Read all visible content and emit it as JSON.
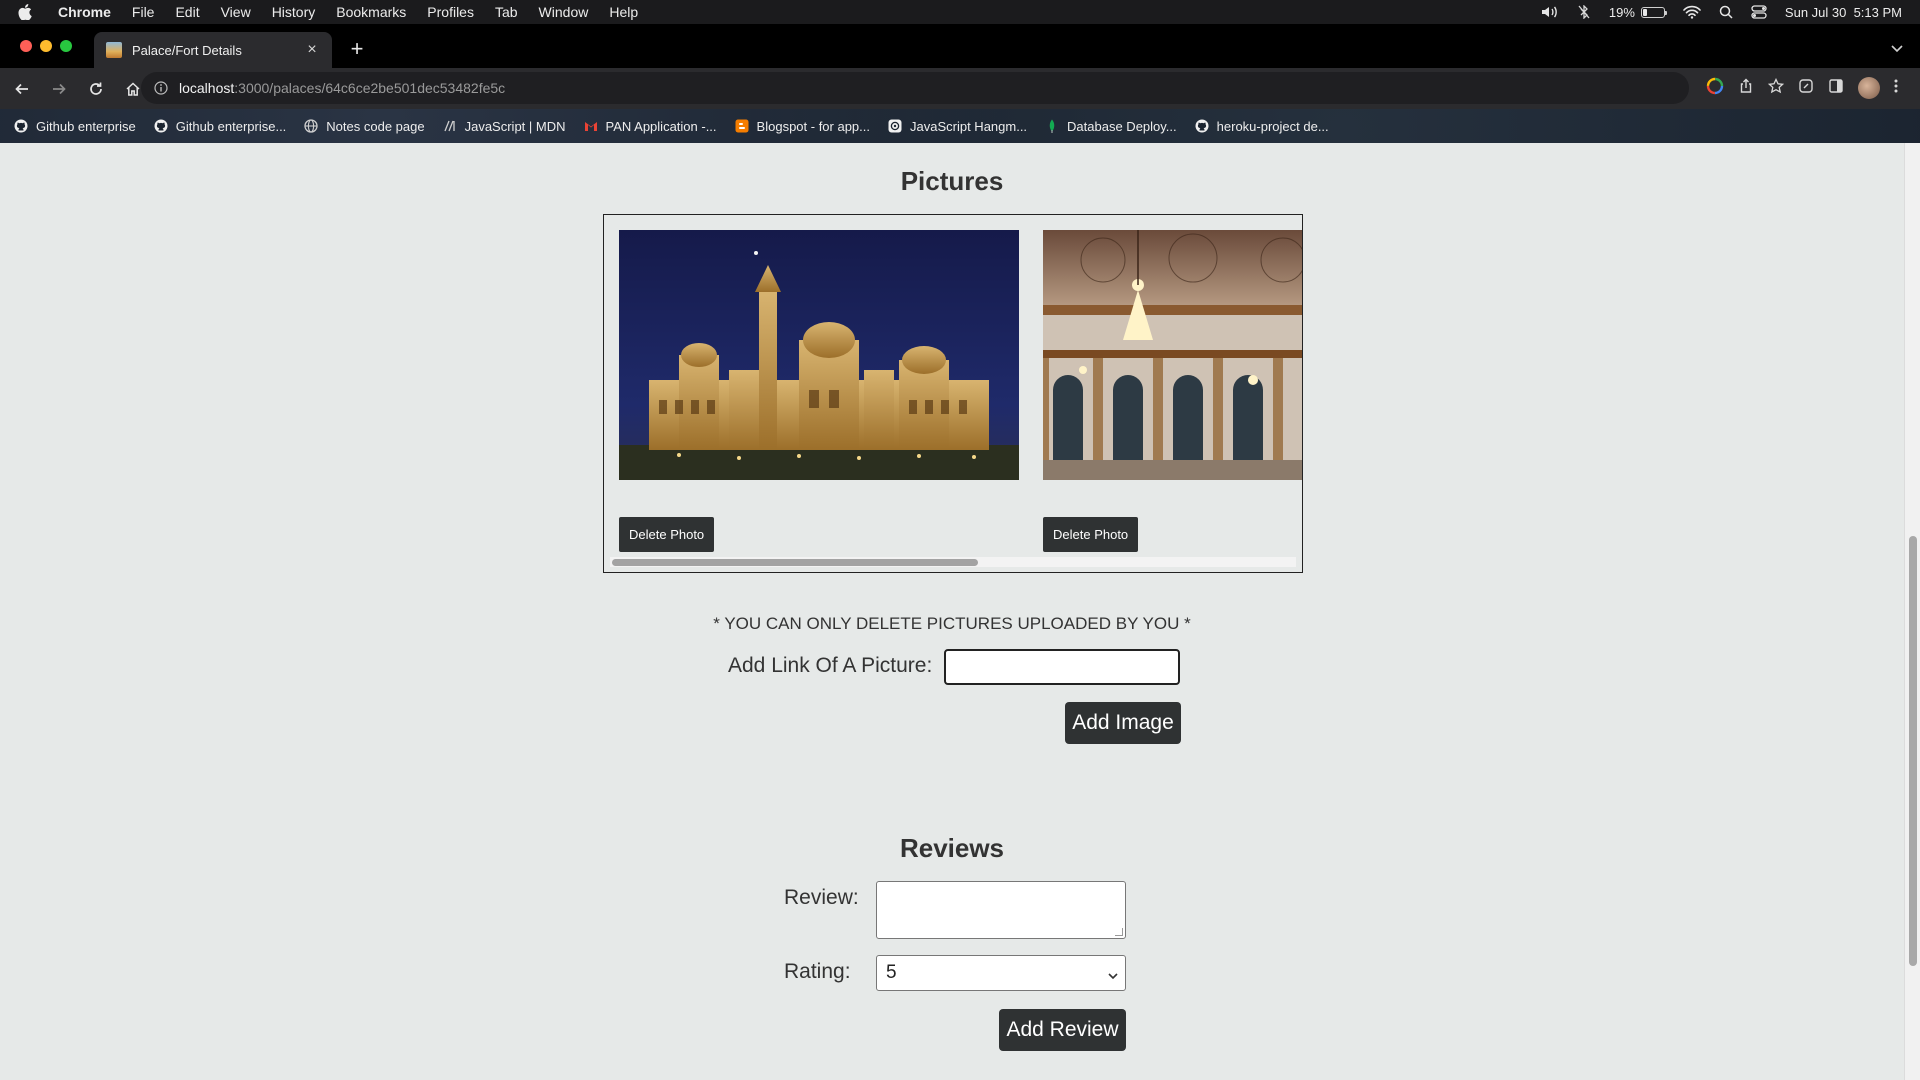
{
  "menubar": {
    "app_name": "Chrome",
    "items": [
      "File",
      "Edit",
      "View",
      "History",
      "Bookmarks",
      "Profiles",
      "Tab",
      "Window",
      "Help"
    ],
    "battery_percent": "19%",
    "battery_level": 0.19,
    "datetime": "Sun Jul 30  5:13 PM"
  },
  "browser": {
    "tab_title": "Palace/Fort Details",
    "url_host": "localhost",
    "url_path": ":3000/palaces/64c6ce2be501dec53482fe5c",
    "bookmarks": [
      {
        "label": "Github enterprise",
        "icon": "github-icon"
      },
      {
        "label": "Github enterprise...",
        "icon": "github-icon"
      },
      {
        "label": "Notes code page",
        "icon": "globe-icon"
      },
      {
        "label": "JavaScript | MDN",
        "icon": "mdn-icon"
      },
      {
        "label": "PAN Application -...",
        "icon": "gmail-icon"
      },
      {
        "label": "Blogspot - for app...",
        "icon": "blogger-icon"
      },
      {
        "label": "JavaScript Hangm...",
        "icon": "openai-icon"
      },
      {
        "label": "Database Deploy...",
        "icon": "mongodb-leaf-icon"
      },
      {
        "label": "heroku-project de...",
        "icon": "github-icon"
      }
    ]
  },
  "pictures": {
    "heading": "Pictures",
    "photos": [
      {
        "alt": "palace-night-exterior",
        "delete_label": "Delete Photo"
      },
      {
        "alt": "palace-interior-chandelier",
        "delete_label": "Delete Photo"
      }
    ],
    "note": "* YOU CAN ONLY DELETE PICTURES UPLOADED BY YOU *",
    "link_label": "Add Link Of A Picture:",
    "link_value": "",
    "add_image_label": "Add Image"
  },
  "reviews": {
    "heading": "Reviews",
    "review_label": "Review:",
    "review_value": "",
    "rating_label": "Rating:",
    "rating_value": "5",
    "add_review_label": "Add Review"
  },
  "colors": {
    "page_bg": "#e6e9e8",
    "button_bg": "#2f3233"
  }
}
